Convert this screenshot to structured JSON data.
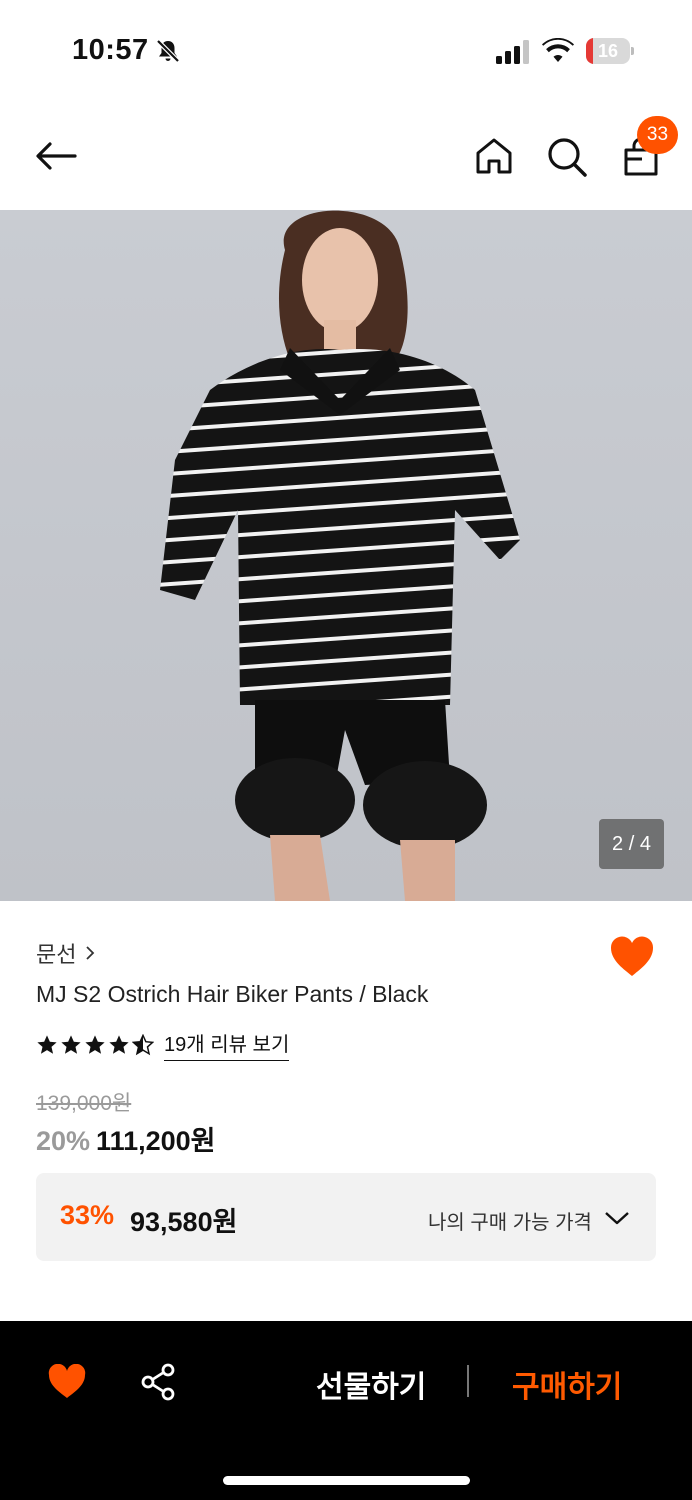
{
  "status_bar": {
    "time": "10:57",
    "battery": "16",
    "battery_level": 0.16,
    "icons": [
      "bell-slash-icon",
      "cellular-signal-icon",
      "wifi-icon",
      "battery-icon"
    ]
  },
  "nav": {
    "icons": [
      "back-arrow-icon",
      "home-icon",
      "search-icon",
      "shopping-bag-icon"
    ],
    "cart_count": "33"
  },
  "product_image": {
    "counter": "2 / 4"
  },
  "product": {
    "brand": "문선",
    "title": "MJ S2 Ostrich Hair Biker Pants / Black",
    "rating": 4.5,
    "review_link": "19개 리뷰 보기",
    "original_price": "139,000원",
    "discount_rate": "20%",
    "sale_price": "111,200원"
  },
  "my_price": {
    "discount_rate": "33%",
    "price": "93,580원",
    "label": "나의 구매 가능 가격"
  },
  "bottom_bar": {
    "gift_label": "선물하기",
    "buy_label": "구매하기"
  },
  "colors": {
    "accent": "#ff5200",
    "buy": "#ff5a00",
    "bar_bg": "#000000"
  }
}
